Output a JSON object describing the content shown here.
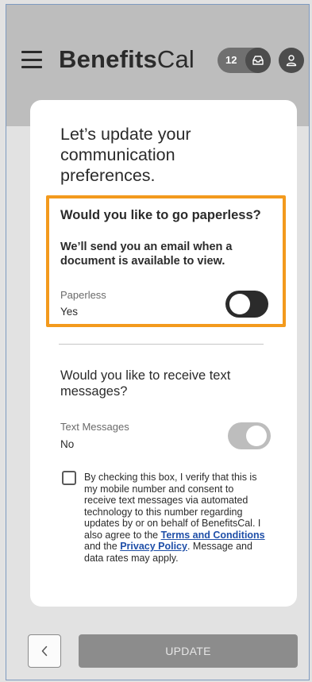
{
  "header": {
    "logo_bold": "Benefits",
    "logo_light": "Cal",
    "inbox_count": "12",
    "icons": [
      "menu-icon",
      "inbox-icon",
      "user-icon"
    ]
  },
  "card": {
    "title": "Let’s update your communication preferences.",
    "paperless": {
      "question": "Would you like to go paperless?",
      "description": "We’ll send you an email when a document is available to view.",
      "label": "Paperless",
      "value": "Yes"
    },
    "text_messages": {
      "question": "Would you like to receive text messages?",
      "label": "Text Messages",
      "value": "No"
    },
    "consent": {
      "part1": "By checking this box, I verify that this is my mobile number and consent to receive text messages via automated technology to this number regarding updates by or on behalf of BenefitsCal. I also agree to the ",
      "terms_link": "Terms and Conditions",
      "part2": " and the ",
      "privacy_link": "Privacy Policy",
      "part3": ". Message and data rates may apply."
    }
  },
  "footer": {
    "back_icon": "chevron-left-icon",
    "update_label": "UPDATE"
  },
  "colors": {
    "highlight": "#f39a1d",
    "link": "#1f4fa8",
    "header": "#bdbdbd"
  }
}
